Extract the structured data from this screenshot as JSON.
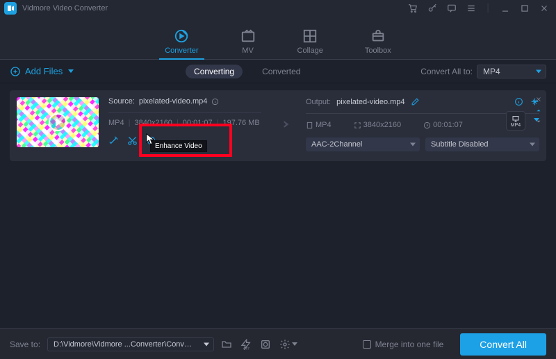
{
  "app": {
    "title": "Vidmore Video Converter"
  },
  "tabs": {
    "converter": "Converter",
    "mv": "MV",
    "collage": "Collage",
    "toolbox": "Toolbox"
  },
  "subbar": {
    "add_files": "Add Files",
    "converting": "Converting",
    "converted": "Converted",
    "convert_to": "Convert All to:",
    "format": "MP4"
  },
  "file": {
    "source_label": "Source:",
    "source_name": "pixelated-video.mp4",
    "container": "MP4",
    "resolution": "3840x2160",
    "duration": "00:01:07",
    "size": "197.76 MB",
    "tooltip": "Enhance Video"
  },
  "output": {
    "label": "Output:",
    "name": "pixelated-video.mp4",
    "container": "MP4",
    "resolution": "3840x2160",
    "duration": "00:01:07",
    "audio": "AAC-2Channel",
    "subtitle": "Subtitle Disabled",
    "badge": "MP4"
  },
  "footer": {
    "save_to": "Save to:",
    "path": "D:\\Vidmore\\Vidmore ...Converter\\Converted",
    "merge": "Merge into one file",
    "convert_all": "Convert All"
  }
}
